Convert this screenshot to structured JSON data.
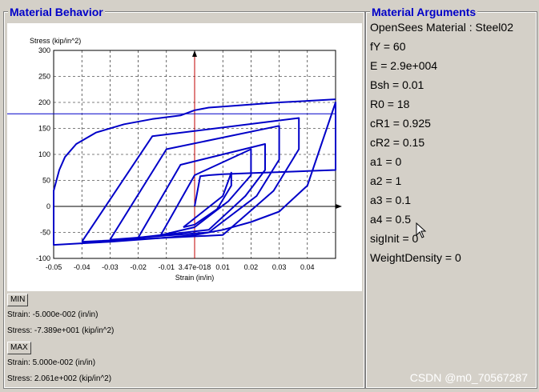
{
  "left_panel": {
    "title": "Material Behavior"
  },
  "right_panel": {
    "title": "Material Arguments"
  },
  "arguments": [
    "OpenSees Material : Steel02",
    "fY = 60",
    "E = 2.9e+004",
    "Bsh = 0.01",
    "R0 = 18",
    "cR1 = 0.925",
    "cR2 = 0.15",
    "a1 = 0",
    "a2 = 1",
    "a3 = 0.1",
    "a4 = 0.5",
    "sigInit = 0",
    "WeightDensity = 0"
  ],
  "min": {
    "label": "MIN",
    "strain": "Strain: -5.000e-002 (in/in)",
    "stress": "Stress: -7.389e+001 (kip/in^2)"
  },
  "max": {
    "label": "MAX",
    "strain": "Strain: 5.000e-002 (in/in)",
    "stress": "Stress: 2.061e+002 (kip/in^2)"
  },
  "watermark": "CSDN @m0_70567287",
  "chart_data": {
    "type": "line",
    "xlabel": "Strain (in/in)",
    "ylabel": "Stress (kip/in^2)",
    "xlim": [
      -0.05,
      0.05
    ],
    "ylim": [
      -100,
      300
    ],
    "xticks": [
      "-0.05",
      "-0.04",
      "-0.03",
      "-0.02",
      "-0.01",
      "3.47e-018",
      "0.01",
      "0.02",
      "0.03",
      "0.04"
    ],
    "xtick_values": [
      -0.05,
      -0.04,
      -0.03,
      -0.02,
      -0.01,
      0,
      0.01,
      0.02,
      0.03,
      0.04
    ],
    "yticks": [
      "-100",
      "-50",
      "0",
      "50",
      "100",
      "150",
      "200",
      "250",
      "300"
    ],
    "ytick_values": [
      -100,
      -50,
      0,
      50,
      100,
      150,
      200,
      250,
      300
    ],
    "grid": true,
    "series_color": "#0000c8",
    "reference_line_color": "#c00000",
    "hline_y": 178,
    "series": [
      {
        "x": [
          0,
          0.002,
          0.005,
          0.01,
          0.02,
          0.03,
          0.04,
          0.05,
          0.05,
          0.045,
          0.04,
          0.03,
          0.02,
          0.01,
          0,
          -0.01,
          -0.02,
          -0.03,
          -0.04,
          -0.05,
          -0.05,
          -0.048,
          -0.046,
          -0.042,
          -0.035,
          -0.025,
          -0.015,
          -0.005,
          0,
          0.005,
          0.01,
          0.02,
          0.03,
          0.04,
          0.05
        ],
        "y": [
          0,
          58,
          60,
          62,
          64,
          66,
          68,
          70,
          200,
          120,
          40,
          -10,
          -30,
          -45,
          -55,
          -60,
          -64,
          -68,
          -71,
          -74,
          30,
          70,
          95,
          120,
          142,
          158,
          168,
          175,
          185,
          190,
          192,
          196,
          200,
          203,
          206
        ]
      }
    ],
    "inner_loops": [
      {
        "x": [
          -0.004,
          0.01,
          0.013,
          0.013,
          0.008,
          0.0,
          -0.004,
          -0.004
        ],
        "y": [
          -40,
          20,
          65,
          40,
          -5,
          -35,
          -40,
          -40
        ]
      },
      {
        "x": [
          -0.012,
          0.0,
          0.02,
          0.02,
          0.012,
          0.0,
          -0.012,
          -0.012
        ],
        "y": [
          -55,
          60,
          110,
          60,
          10,
          -40,
          -55,
          -55
        ]
      },
      {
        "x": [
          -0.02,
          -0.005,
          0.025,
          0.025,
          0.018,
          0.005,
          -0.02,
          -0.02
        ],
        "y": [
          -60,
          80,
          120,
          70,
          20,
          -45,
          -60,
          -60
        ]
      },
      {
        "x": [
          -0.03,
          -0.01,
          0.03,
          0.03,
          0.022,
          0.005,
          -0.03,
          -0.03
        ],
        "y": [
          -64,
          110,
          155,
          90,
          20,
          -50,
          -64,
          -64
        ]
      },
      {
        "x": [
          -0.04,
          -0.015,
          0.037,
          0.037,
          0.028,
          0.01,
          -0.04,
          -0.04
        ],
        "y": [
          -68,
          135,
          170,
          110,
          30,
          -55,
          -68,
          -68
        ]
      }
    ]
  }
}
